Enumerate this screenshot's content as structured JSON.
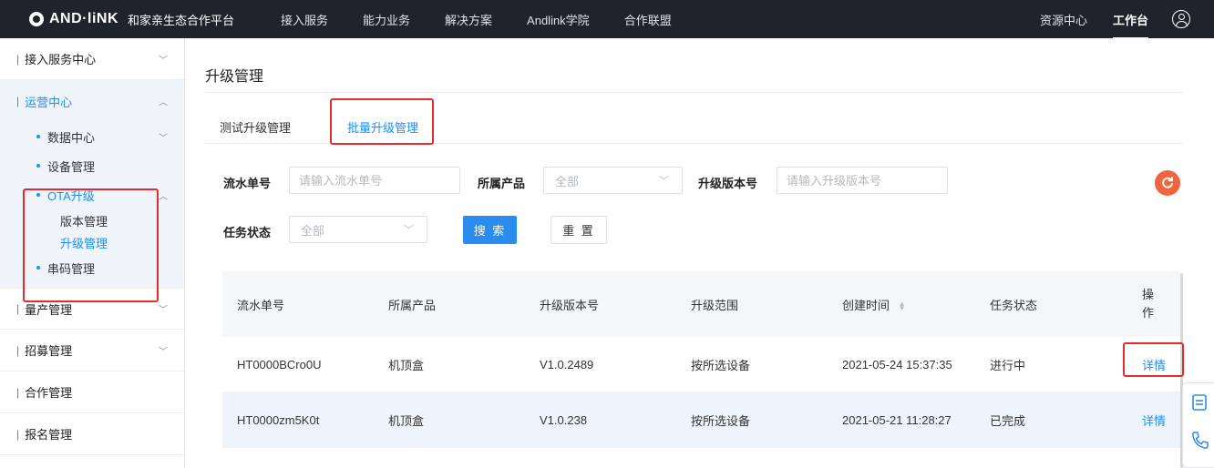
{
  "topbar": {
    "logo_text": "AND·liNK",
    "platform_name": "和家亲生态合作平台",
    "nav": [
      "接入服务",
      "能力业务",
      "解决方案",
      "Andlink学院",
      "合作联盟"
    ],
    "resource_center": "资源中心",
    "workbench": "工作台"
  },
  "sidebar": {
    "groups": {
      "access": "接入服务中心",
      "ops": "运营中心",
      "mass": "量产管理",
      "recruit": "招募管理",
      "coop": "合作管理",
      "signup": "报名管理"
    },
    "ops_items": {
      "data_center": "数据中心",
      "device_mgmt": "设备管理",
      "ota": "OTA升级",
      "version_mgmt": "版本管理",
      "upgrade_mgmt": "升级管理",
      "serial_mgmt": "串码管理"
    }
  },
  "main": {
    "title": "升级管理",
    "tabs": [
      "测试升级管理",
      "批量升级管理"
    ],
    "filters": {
      "serial_label": "流水单号",
      "serial_placeholder": "请输入流水单号",
      "product_label": "所属产品",
      "product_value": "全部",
      "version_label": "升级版本号",
      "version_placeholder": "请输入升级版本号",
      "status_label": "任务状态",
      "status_value": "全部",
      "search_button": "搜 索",
      "reset_button": "重 置"
    },
    "table": {
      "headers": [
        "流水单号",
        "所属产品",
        "升级版本号",
        "升级范围",
        "创建时间",
        "任务状态",
        "操作"
      ],
      "rows": [
        {
          "serial": "HT0000BCro0U",
          "product": "机顶盒",
          "version": "V1.0.2489",
          "scope": "按所选设备",
          "created": "2021-05-24 15:37:35",
          "status": "进行中",
          "action": "详情"
        },
        {
          "serial": "HT0000zm5K0t",
          "product": "机顶盒",
          "version": "V1.0.238",
          "scope": "按所选设备",
          "created": "2021-05-21 11:28:27",
          "status": "已完成",
          "action": "详情"
        }
      ]
    }
  },
  "colors": {
    "accent": "#1890ff",
    "topbar_bg": "#1f232b",
    "highlight_red": "#e52b2b",
    "refresh_orange": "#f2643d"
  }
}
